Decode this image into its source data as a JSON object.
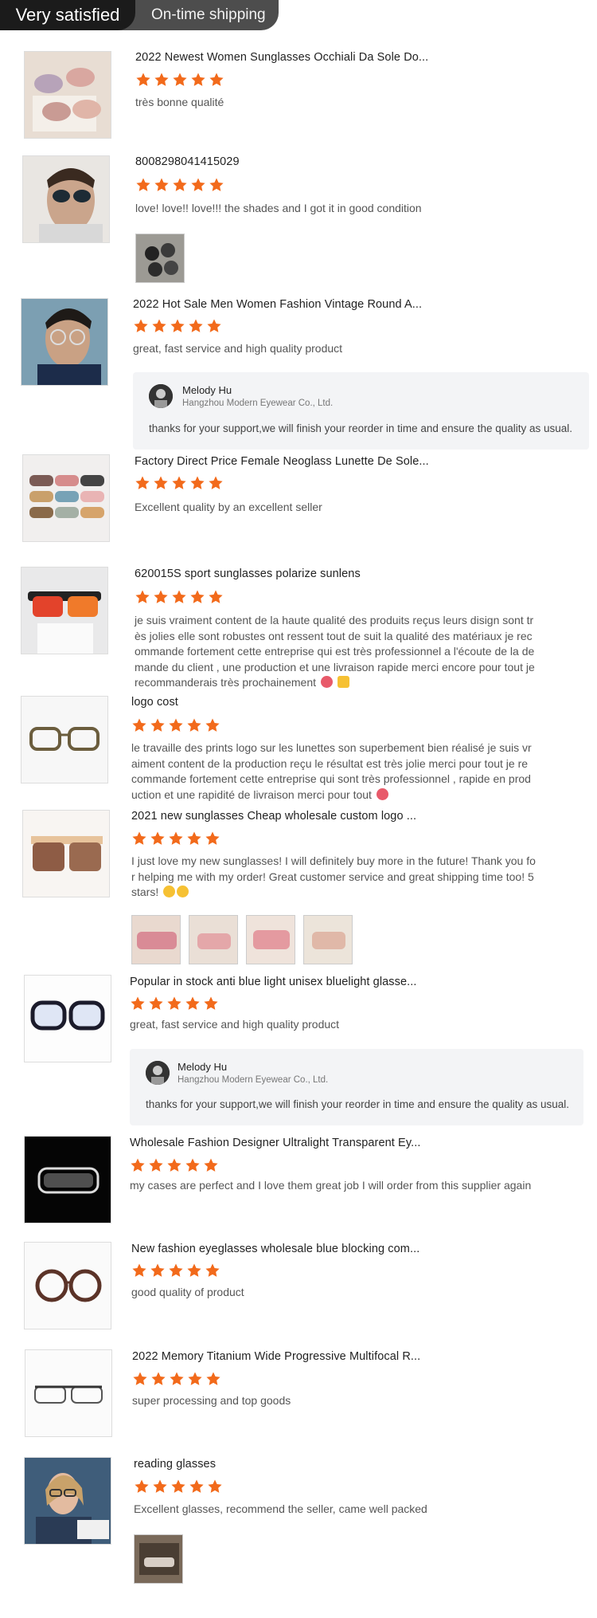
{
  "tabs": {
    "active": "Very satisfied",
    "other": "On-time shipping"
  },
  "colors": {
    "star": "#f26a1b",
    "tab_active_bg": "#1b1b1b",
    "tab_bg": "#4d4d4d",
    "reply_bg": "#f3f4f6"
  },
  "reviews": [
    {
      "title": "2022 Newest Women Sunglasses Occhiali Da Sole Do...",
      "rating": 5,
      "comment": "très bonne qualité"
    },
    {
      "title": "8008298041415029",
      "rating": 5,
      "comment": "love! love!! love!!! the shades and I got it in good condition"
    },
    {
      "title": "2022 Hot Sale Men Women Fashion Vintage Round A...",
      "rating": 5,
      "comment": "great, fast service and high quality product",
      "reply": {
        "name": "Melody Hu",
        "company": "Hangzhou Modern Eyewear Co., Ltd.",
        "text": "thanks for your support,we will finish your reorder in time and ensure the quality as usual."
      }
    },
    {
      "title": "Factory Direct Price Female Neoglass Lunette De Sole...",
      "rating": 5,
      "comment": "Excellent quality by an excellent seller"
    },
    {
      "title": "620015S sport sunglasses polarize sunlens",
      "rating": 5,
      "comment_lines": [
        "je suis vraiment content de la haute qualité des produits reçus leurs disign sont tr",
        "ès jolies elle sont robustes ont ressent tout de suit la qualité des matériaux je rec",
        "ommande fortement cette entreprise qui est très professionnel a l'écoute de la de",
        "mande du client ,  une production et une livraison rapide merci encore pour tout je",
        "recommanderais très prochainement"
      ]
    },
    {
      "title": "logo cost",
      "rating": 5,
      "comment_lines": [
        "le travaille des prints logo sur les lunettes son superbement bien réalisé je suis vr",
        "aiment content de la production reçu le résultat est très jolie merci pour tout je re",
        "commande fortement cette entreprise qui sont très professionnel , rapide en prod",
        "uction et une rapidité de livraison merci pour tout"
      ]
    },
    {
      "title": "2021 new sunglasses Cheap wholesale custom logo ...",
      "rating": 5,
      "comment_lines": [
        "I just love my new sunglasses! I will definitely buy more in the future! Thank you fo",
        "r helping me with my order! Great customer service and great shipping time too! 5",
        "stars!"
      ]
    },
    {
      "title": "Popular in stock anti blue light unisex bluelight glasse...",
      "rating": 5,
      "comment": "great, fast service and high quality product",
      "reply": {
        "name": "Melody Hu",
        "company": "Hangzhou Modern Eyewear Co., Ltd.",
        "text": "thanks for your support,we will finish your reorder in time and ensure the quality as usual."
      }
    },
    {
      "title": "Wholesale Fashion Designer Ultralight Transparent Ey...",
      "rating": 5,
      "comment": "my cases are perfect and I love them great job I will order from this supplier again"
    },
    {
      "title": "New fashion eyeglasses wholesale blue blocking com...",
      "rating": 5,
      "comment": "good quality of product"
    },
    {
      "title": "2022 Memory Titanium Wide Progressive Multifocal R...",
      "rating": 5,
      "comment": "super processing and top goods"
    },
    {
      "title": "reading glasses",
      "rating": 5,
      "comment": "Excellent glasses, recommend the seller, came well packed"
    }
  ]
}
